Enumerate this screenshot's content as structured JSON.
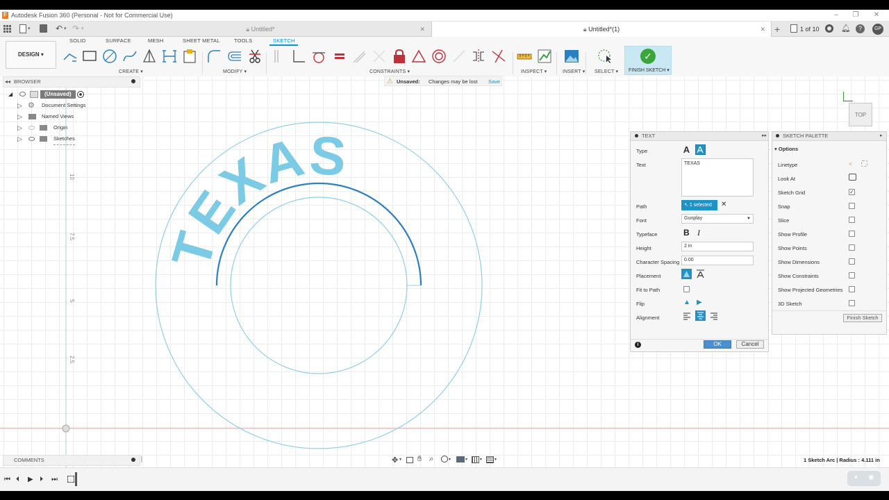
{
  "titlebar": {
    "app_title": "Autodesk Fusion 360 (Personal - Not for Commercial Use)"
  },
  "tabs": {
    "inactive": {
      "label": "Untitled*"
    },
    "active": {
      "label": "Untitled*(1)"
    },
    "page_count": "1 of 10",
    "user_initials": "GP"
  },
  "ribbon": {
    "workspace": "DESIGN ▾",
    "tabs": [
      "SOLID",
      "SURFACE",
      "MESH",
      "SHEET METAL",
      "TOOLS",
      "SKETCH"
    ],
    "groups": {
      "create": "CREATE ▾",
      "modify": "MODIFY ▾",
      "constraints": "CONSTRAINTS ▾",
      "inspect": "INSPECT ▾",
      "insert": "INSERT ▾",
      "select": "SELECT ▾",
      "finish_sketch": "FINISH SKETCH ▾"
    }
  },
  "browser": {
    "title": "BROWSER",
    "root": "(Unsaved)",
    "items": [
      "Document Settings",
      "Named Views",
      "Origin",
      "Sketches"
    ]
  },
  "unsaved_bar": {
    "label": "Unsaved:",
    "message": "Changes may be lost",
    "save": "Save"
  },
  "viewcube": {
    "label": "TOP"
  },
  "sketch_text": "TEXAS",
  "ruler_labels": [
    "10",
    "7.5",
    "5",
    "2.5"
  ],
  "text_dialog": {
    "title": "TEXT",
    "rows": {
      "type": "Type",
      "text": "Text",
      "path": "Path",
      "font": "Font",
      "typeface": "Typeface",
      "height": "Height",
      "char_spacing": "Character Spacing",
      "placement": "Placement",
      "fit_to_path": "Fit to Path",
      "flip": "Flip",
      "alignment": "Alignment"
    },
    "text_value": "TEXAS",
    "path_value": "1 selected",
    "font_value": "Gunplay",
    "height_value": "2 in",
    "spacing_value": "0.00",
    "ok": "OK",
    "cancel": "Cancel"
  },
  "sketch_palette": {
    "title": "SKETCH PALETTE",
    "section": "Options",
    "rows": [
      "Linetype",
      "Look At",
      "Sketch Grid",
      "Snap",
      "Slice",
      "Show Profile",
      "Show Points",
      "Show Dimensions",
      "Show Constraints",
      "Show Projected Geometries",
      "3D Sketch"
    ],
    "finish": "Finish Sketch"
  },
  "comments": {
    "title": "COMMENTS"
  },
  "status": {
    "text": "1 Sketch Arc | Radius : 4.111 in"
  },
  "colors": {
    "accent": "#0696d7",
    "sketch_line": "#8fd0e8",
    "selected_arc": "#2d7fc2",
    "text_fill": "#7ccbe6"
  }
}
